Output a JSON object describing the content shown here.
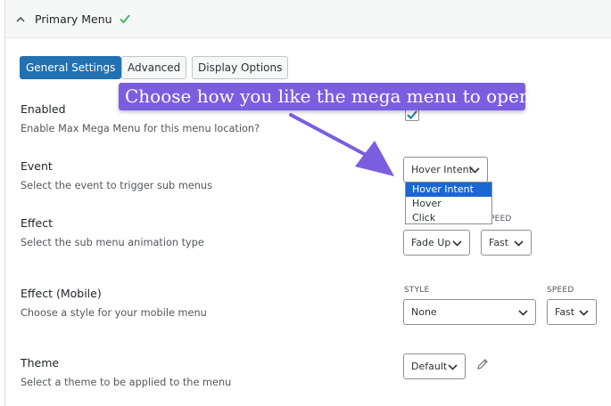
{
  "panel": {
    "title": "Primary Menu"
  },
  "tabs": [
    {
      "label": "General Settings",
      "active": true
    },
    {
      "label": "Advanced",
      "active": false
    },
    {
      "label": "Display Options",
      "active": false
    }
  ],
  "callout": {
    "text": "Choose how you like the mega menu to open",
    "color": "#7b5ee0"
  },
  "settings": {
    "enabled": {
      "label": "Enabled",
      "description": "Enable Max Mega Menu for this menu location?",
      "checked": true
    },
    "event": {
      "label": "Event",
      "description": "Select the event to trigger sub menus",
      "value": "Hover Intent",
      "options": [
        "Hover Intent",
        "Hover",
        "Click"
      ],
      "selected_option": "Hover Intent"
    },
    "effect": {
      "label": "Effect",
      "description": "Select the sub menu animation type",
      "speed_header_partial": "PEED",
      "style_value": "Fade Up",
      "speed_value": "Fast"
    },
    "effect_mobile": {
      "label": "Effect (Mobile)",
      "description": "Choose a style for your mobile menu",
      "style_header": "STYLE",
      "speed_header": "SPEED",
      "style_value": "None",
      "speed_value": "Fast"
    },
    "theme": {
      "label": "Theme",
      "description": "Select a theme to be applied to the menu",
      "value": "Default"
    }
  },
  "colors": {
    "accent": "#2271b1",
    "check_green": "#4ab866",
    "dropdown_highlight": "#1967d2"
  }
}
